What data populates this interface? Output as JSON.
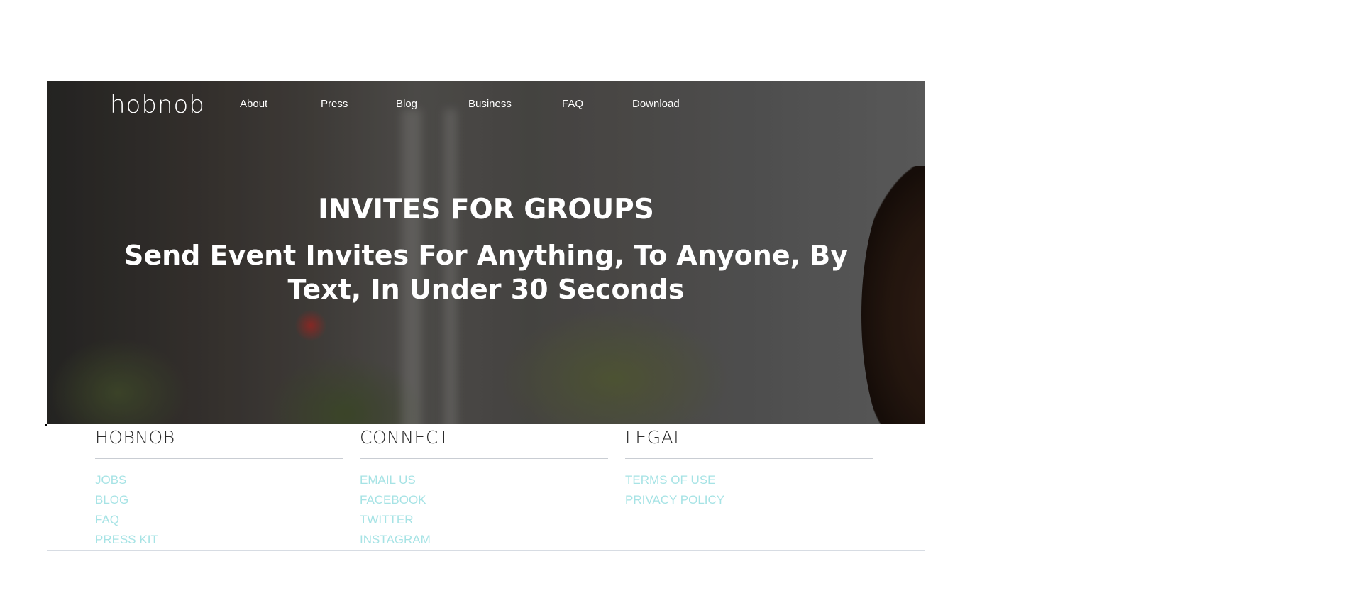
{
  "header": {
    "logo": "hobnob",
    "nav": [
      "About",
      "Press",
      "Blog",
      "Business",
      "FAQ",
      "Download"
    ]
  },
  "hero": {
    "title": "INVITES FOR GROUPS",
    "subtitle": "Send Event Invites For Anything, To Anyone, By Text, In Under 30 Seconds"
  },
  "footer": {
    "columns": [
      {
        "heading": "HOBNOB",
        "links": [
          "JOBS",
          "BLOG",
          "FAQ",
          "PRESS KIT"
        ]
      },
      {
        "heading": "CONNECT",
        "links": [
          "EMAIL US",
          "FACEBOOK",
          "TWITTER",
          "INSTAGRAM"
        ]
      },
      {
        "heading": "LEGAL",
        "links": [
          "TERMS OF USE",
          "PRIVACY POLICY"
        ]
      }
    ]
  },
  "colors": {
    "footer_link": "#a6e3e5",
    "footer_heading": "#2b2b2b",
    "hero_text": "#ffffff"
  }
}
